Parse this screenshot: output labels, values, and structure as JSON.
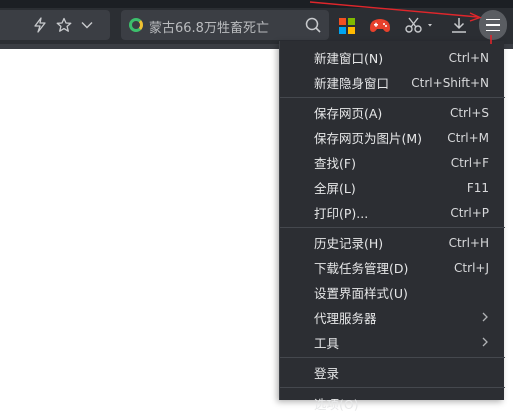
{
  "toolbar": {
    "search_text": "蒙古66.8万牲畜死亡",
    "icons": [
      "lightning-icon",
      "star-icon",
      "chevron-down-icon",
      "search-icon",
      "microsoft-icon",
      "game-icon",
      "scissors-icon",
      "download-icon",
      "menu-icon"
    ]
  },
  "menu": {
    "items": [
      {
        "label": "新建窗口(N)",
        "shortcut": "Ctrl+N"
      },
      {
        "label": "新建隐身窗口",
        "shortcut": "Ctrl+Shift+N"
      },
      {
        "label": "保存网页(A)",
        "shortcut": "Ctrl+S"
      },
      {
        "label": "保存网页为图片(M)",
        "shortcut": "Ctrl+M"
      },
      {
        "label": "查找(F)",
        "shortcut": "Ctrl+F"
      },
      {
        "label": "全屏(L)",
        "shortcut": "F11"
      },
      {
        "label": "打印(P)...",
        "shortcut": "Ctrl+P"
      },
      {
        "label": "历史记录(H)",
        "shortcut": "Ctrl+H"
      },
      {
        "label": "下载任务管理(D)",
        "shortcut": "Ctrl+J"
      },
      {
        "label": "设置界面样式(U)",
        "shortcut": ""
      },
      {
        "label": "代理服务器",
        "shortcut": "",
        "submenu": true
      },
      {
        "label": "工具",
        "shortcut": "",
        "submenu": true
      },
      {
        "label": "登录",
        "shortcut": ""
      },
      {
        "label": "选项(O)",
        "shortcut": ""
      }
    ]
  },
  "colors": {
    "toolbar_bg": "#2b2e33",
    "menu_bg": "#2c2e33",
    "annotation_red": "#e0262b"
  }
}
